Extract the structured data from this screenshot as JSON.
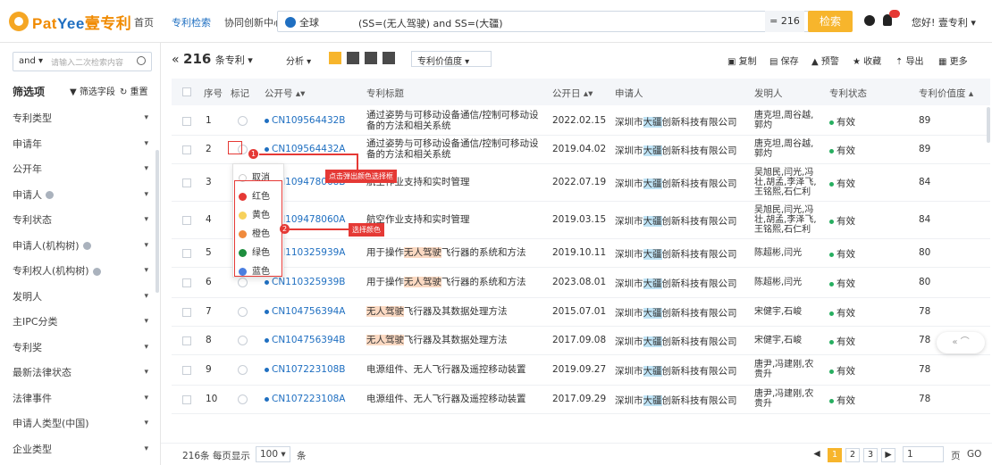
{
  "logo": {
    "part1": "Pat",
    "part2": "Yee",
    "part3": "壹专利"
  },
  "nav": {
    "home": "首页",
    "search": "专利检索",
    "collab": "协同创新中心"
  },
  "search": {
    "scope": "全球",
    "query": "(SS=(无人驾驶) and SS=(大疆)",
    "count": "= 216",
    "button": "检索"
  },
  "user": {
    "greeting": "您好! 壹专利 ▾"
  },
  "sidebar": {
    "logic": "and ▾",
    "placeholder": "请输入二次检索内容",
    "filter_title": "筛选项",
    "filter_fields": "▼ 筛选字段",
    "reset": "↻ 重置",
    "items": [
      {
        "label": "专利类型",
        "help": false
      },
      {
        "label": "申请年",
        "help": false
      },
      {
        "label": "公开年",
        "help": false
      },
      {
        "label": "申请人",
        "help": true
      },
      {
        "label": "专利状态",
        "help": false
      },
      {
        "label": "申请人(机构树)",
        "help": true
      },
      {
        "label": "专利权人(机构树)",
        "help": true
      },
      {
        "label": "发明人",
        "help": false
      },
      {
        "label": "主IPC分类",
        "help": false
      },
      {
        "label": "专利奖",
        "help": false
      },
      {
        "label": "最新法律状态",
        "help": false
      },
      {
        "label": "法律事件",
        "help": false
      },
      {
        "label": "申请人类型(中国)",
        "help": false
      },
      {
        "label": "企业类型",
        "help": false
      }
    ]
  },
  "toolbar": {
    "collapse": "«",
    "count_num": "216",
    "count_unit": "条专利 ▾",
    "analyze": "分析 ▾",
    "sort": "专利价值度    ▾",
    "copy": "复制",
    "save": "保存",
    "alert": "预警",
    "fav": "收藏",
    "export": "导出",
    "more": "更多"
  },
  "columns": {
    "index": "序号",
    "mark": "标记",
    "pubno": "公开号 ▴▾",
    "title": "专利标题",
    "pubdate": "公开日 ▴▾",
    "applicant": "申请人",
    "inventor": "发明人",
    "status": "专利状态",
    "value": "专利价值度 ▴"
  },
  "rows": [
    {
      "idx": "1",
      "pubno": "CN109564432B",
      "title": [
        "通过姿势与可移动设备通信/控制可移动设",
        "备的方法和相关系统"
      ],
      "date": "2022.02.15",
      "app": [
        "深圳市",
        "大疆",
        "创新科技有限公司"
      ],
      "inv": [
        "唐克坦,周谷越,",
        "郭灼"
      ],
      "status": "有效",
      "value": "89"
    },
    {
      "idx": "2",
      "pubno": "CN109564432A",
      "title": [
        "通过姿势与可移动设备通信/控制可移动设",
        "备的方法和相关系统"
      ],
      "date": "2019.04.02",
      "app": [
        "深圳市",
        "大疆",
        "创新科技有限公司"
      ],
      "inv": [
        "唐克坦,周谷越,",
        "郭灼"
      ],
      "status": "有效",
      "value": "89"
    },
    {
      "idx": "3",
      "pubno": "CN109478068B",
      "title": [
        "航空作业支持和实时管理",
        ""
      ],
      "date": "2022.07.19",
      "app": [
        "深圳市",
        "大疆",
        "创新科技有限公司"
      ],
      "inv": [
        "吴旭民,闫光,冯",
        "壮,胡孟,李泽飞,",
        "王铭熙,石仁利"
      ],
      "status": "有效",
      "value": "84"
    },
    {
      "idx": "4",
      "pubno": "CN109478060A",
      "title": [
        "航空作业支持和实时管理",
        ""
      ],
      "date": "2019.03.15",
      "app": [
        "深圳市",
        "大疆",
        "创新科技有限公司"
      ],
      "inv": [
        "吴旭民,闫光,冯",
        "壮,胡孟,李泽飞,",
        "王铭熙,石仁利"
      ],
      "status": "有效",
      "value": "84"
    },
    {
      "idx": "5",
      "pubno": "CN110325939A",
      "title": [
        "用于操作",
        "无人驾驶",
        "飞行器的系统和方法"
      ],
      "date": "2019.10.11",
      "app": [
        "深圳市",
        "大疆",
        "创新科技有限公司"
      ],
      "inv": [
        "陈超彬,闫光",
        "",
        ""
      ],
      "status": "有效",
      "value": "80"
    },
    {
      "idx": "6",
      "pubno": "CN110325939B",
      "title": [
        "用于操作",
        "无人驾驶",
        "飞行器的系统和方法"
      ],
      "date": "2023.08.01",
      "app": [
        "深圳市",
        "大疆",
        "创新科技有限公司"
      ],
      "inv": [
        "陈超彬,闫光",
        "",
        ""
      ],
      "status": "有效",
      "value": "80"
    },
    {
      "idx": "7",
      "pubno": "CN104756394A",
      "title": [
        "",
        "无人驾驶",
        "飞行器及其数据处理方法"
      ],
      "date": "2015.07.01",
      "app": [
        "深圳市",
        "大疆",
        "创新科技有限公司"
      ],
      "inv": [
        "宋健宇,石峻",
        "",
        ""
      ],
      "status": "有效",
      "value": "78"
    },
    {
      "idx": "8",
      "pubno": "CN104756394B",
      "title": [
        "",
        "无人驾驶",
        "飞行器及其数据处理方法"
      ],
      "date": "2017.09.08",
      "app": [
        "深圳市",
        "大疆",
        "创新科技有限公司"
      ],
      "inv": [
        "宋健宇,石峻",
        "",
        ""
      ],
      "status": "有效",
      "value": "78"
    },
    {
      "idx": "9",
      "pubno": "CN107223108B",
      "title": [
        "电源组件、无人飞行器及遥控移动装置",
        ""
      ],
      "date": "2019.09.27",
      "app": [
        "深圳市",
        "大疆",
        "创新科技有限公司"
      ],
      "inv": [
        "唐尹,冯建刚,农",
        "贵升"
      ],
      "status": "有效",
      "value": "78"
    },
    {
      "idx": "10",
      "pubno": "CN107223108A",
      "title": [
        "电源组件、无人飞行器及遥控移动装置",
        ""
      ],
      "date": "2017.09.29",
      "app": [
        "深圳市",
        "大疆",
        "创新科技有限公司"
      ],
      "inv": [
        "唐尹,冯建刚,农",
        "贵升"
      ],
      "status": "有效",
      "value": "78"
    }
  ],
  "popup": {
    "cancel": "取消",
    "red": "红色",
    "yellow": "黄色",
    "orange": "橙色",
    "green": "绿色",
    "blue": "蓝色"
  },
  "annotations": {
    "step1": "点击弹出颜色选择框",
    "step2": "选择颜色",
    "n1": "1",
    "n2": "2"
  },
  "pagination": {
    "summary": "216条 每页显示",
    "per_page": "100 ▾",
    "unit": "条",
    "prev": "◀",
    "p1": "1",
    "p2": "2",
    "p3": "3",
    "next": "▶",
    "jump_value": "1",
    "page_label": "页",
    "go": "GO"
  },
  "float": {
    "label": "« ⌒"
  },
  "colors": {
    "accent": "#f7b52c",
    "link": "#1f6fc1",
    "valid": "#27ae60",
    "annot": "#e53935"
  }
}
